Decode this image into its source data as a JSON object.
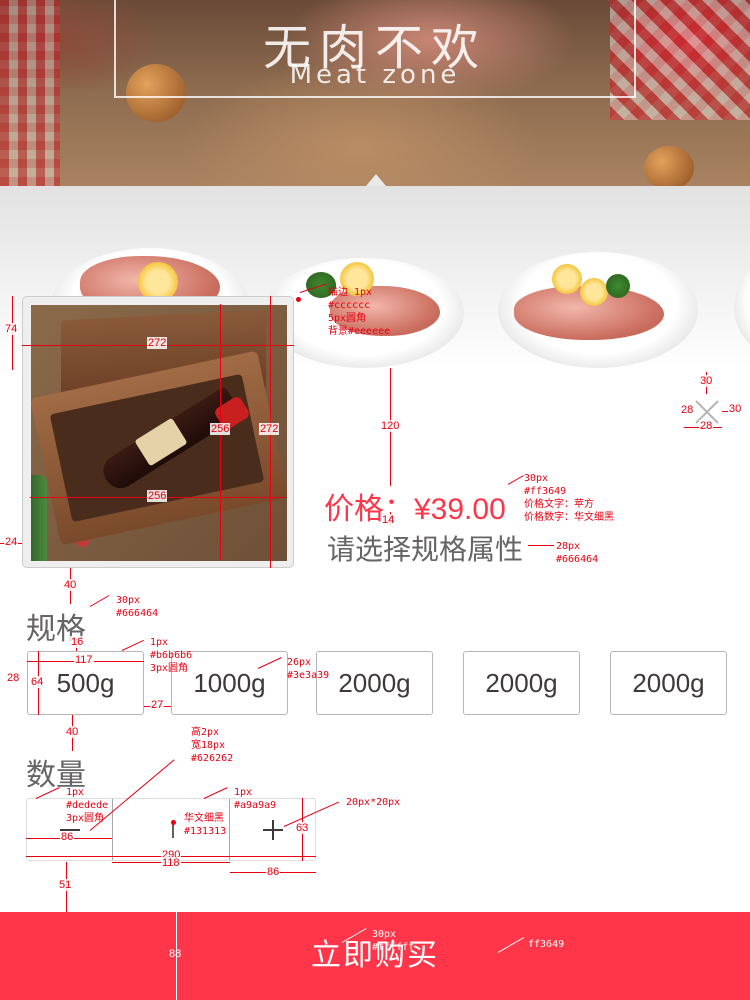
{
  "banner": {
    "title": "无肉不欢",
    "subtitle": "Meat zone"
  },
  "product": {
    "price_label": "价格：",
    "price_value": "¥39.00",
    "select_hint": "请选择规格属性"
  },
  "spec": {
    "title": "规格",
    "options": [
      "500g",
      "1000g",
      "2000g",
      "2000g",
      "2000g"
    ]
  },
  "quantity": {
    "title": "数量",
    "value": "1"
  },
  "buy_button": {
    "label": "立即购买"
  },
  "colors": {
    "accent": "#ff3649",
    "hint_text": "#666464",
    "option_text": "#3e3a39",
    "option_border": "#b6b6b6",
    "stepper_border": "#dedede",
    "stepper_divider": "#a9a9a9",
    "quantity_text": "#131313",
    "annotation": "#e60012"
  },
  "annotations": {
    "card_note": [
      "描边 1px",
      "#cccccc",
      "5px圆角",
      "背景#eeeeee"
    ],
    "price_note": [
      "30px",
      "#ff3649",
      "价格文字：苹方",
      "价格数字：华文细黑"
    ],
    "hint_note": [
      "28px",
      "#666464"
    ],
    "spec_title_note": [
      "30px",
      "#666464"
    ],
    "option_note": [
      "1px",
      "#b6b6b6",
      "3px圆角"
    ],
    "option_text_note": [
      "26px",
      "#3e3a39"
    ],
    "cursor_note": [
      "高2px",
      "宽18px",
      "#626262"
    ],
    "stepper_border_note": [
      "1px",
      "#dedede",
      "3px圆角"
    ],
    "divider_note": [
      "1px",
      "#a9a9a9"
    ],
    "plus_note": "20px*20px",
    "qty_font_note": [
      "华文细黑",
      "#131313"
    ],
    "buy_text_note": [
      "30px",
      "#ffffff"
    ],
    "buy_bg_note": "ff3649",
    "dims": {
      "card_h_left": "74",
      "card_w": "272",
      "photo_w": "256",
      "photo_h": "256",
      "card_h_right": "272",
      "card_bottom_left": "24",
      "card_gap": "40",
      "price_offset": "120",
      "price_gap": "14",
      "close_top": "30",
      "close_left": "28",
      "close_right": "30",
      "close_bottom": "28",
      "spec_gap": "16",
      "option_w": "117",
      "option_left": "28",
      "option_h": "64",
      "option_gap": "27",
      "qty_gap": "40",
      "minus_w": "86",
      "stepper_w": "290",
      "value_w": "118",
      "plus_w": "86",
      "stepper_h": "63",
      "buy_gap": "51",
      "buy_h": "88"
    }
  }
}
